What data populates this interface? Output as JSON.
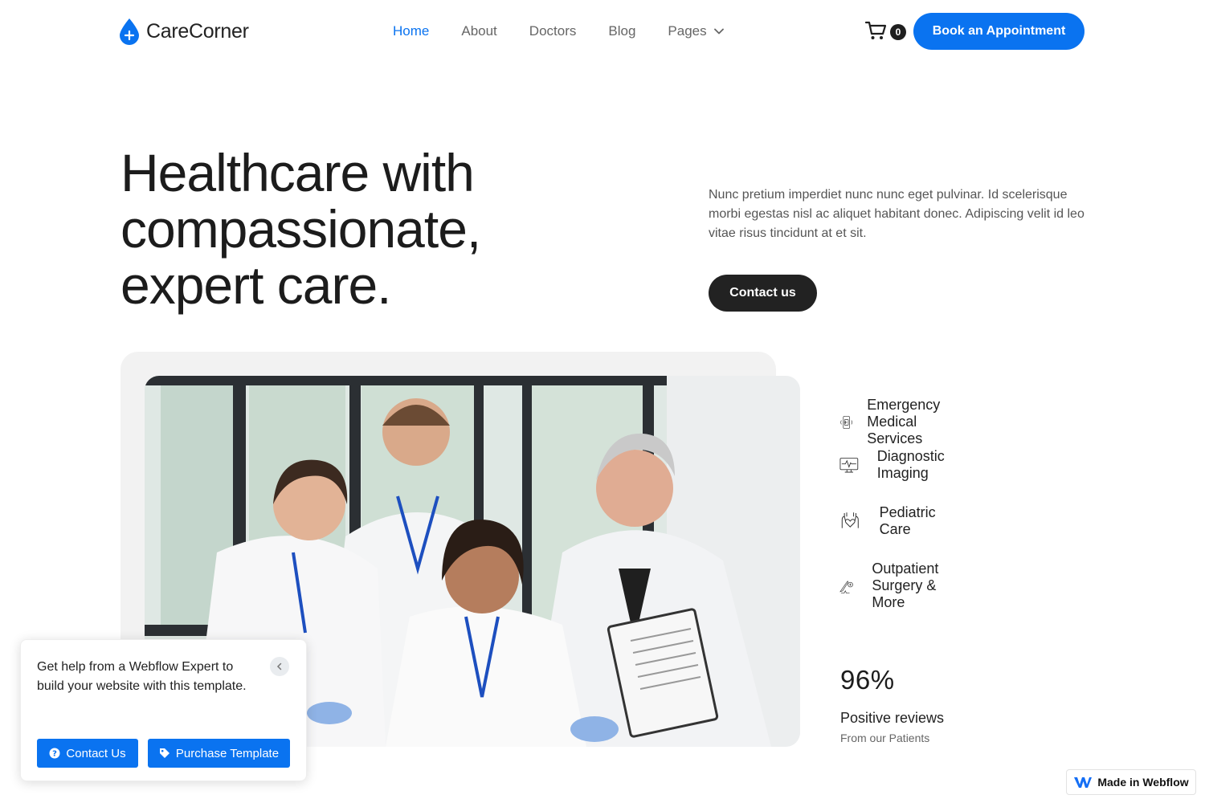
{
  "brand": {
    "name": "CareCorner",
    "accent": "#0a73f0",
    "dark": "#222222"
  },
  "nav": {
    "items": [
      {
        "label": "Home",
        "active": true
      },
      {
        "label": "About",
        "active": false
      },
      {
        "label": "Doctors",
        "active": false
      },
      {
        "label": "Blog",
        "active": false
      },
      {
        "label": "Pages",
        "active": false,
        "icon": "chevron-down-icon"
      }
    ],
    "cart_count": "0",
    "cart_icon": "cart-icon",
    "cta": "Book an Appointment"
  },
  "hero": {
    "title_line1": "Healthcare with",
    "title_line2": "compassionate,",
    "title_line3": "expert care.",
    "description": "Nunc pretium imperdiet nunc nunc eget pulvinar. Id scelerisque morbi egestas nisl ac aliquet habitant donec. Adipiscing velit id leo vitae risus tincidunt at et sit.",
    "contact_button": "Contact us"
  },
  "services": [
    {
      "label": "Emergency Medical Services",
      "icon": "mobile-medical-icon"
    },
    {
      "label": "Diagnostic Imaging",
      "icon": "monitor-pulse-icon"
    },
    {
      "label": "Pediatric Care",
      "icon": "hands-heart-icon"
    },
    {
      "label": "Outpatient Surgery & More",
      "icon": "scalpel-icon"
    }
  ],
  "stats": {
    "value": "96%",
    "label": "Positive reviews",
    "sub": "From our Patients"
  },
  "popup": {
    "text": "Get help from a Webflow Expert to build your website with this template.",
    "contact_button": "Contact Us",
    "purchase_button": "Purchase Template"
  },
  "badge": {
    "label": "Made in Webflow"
  }
}
